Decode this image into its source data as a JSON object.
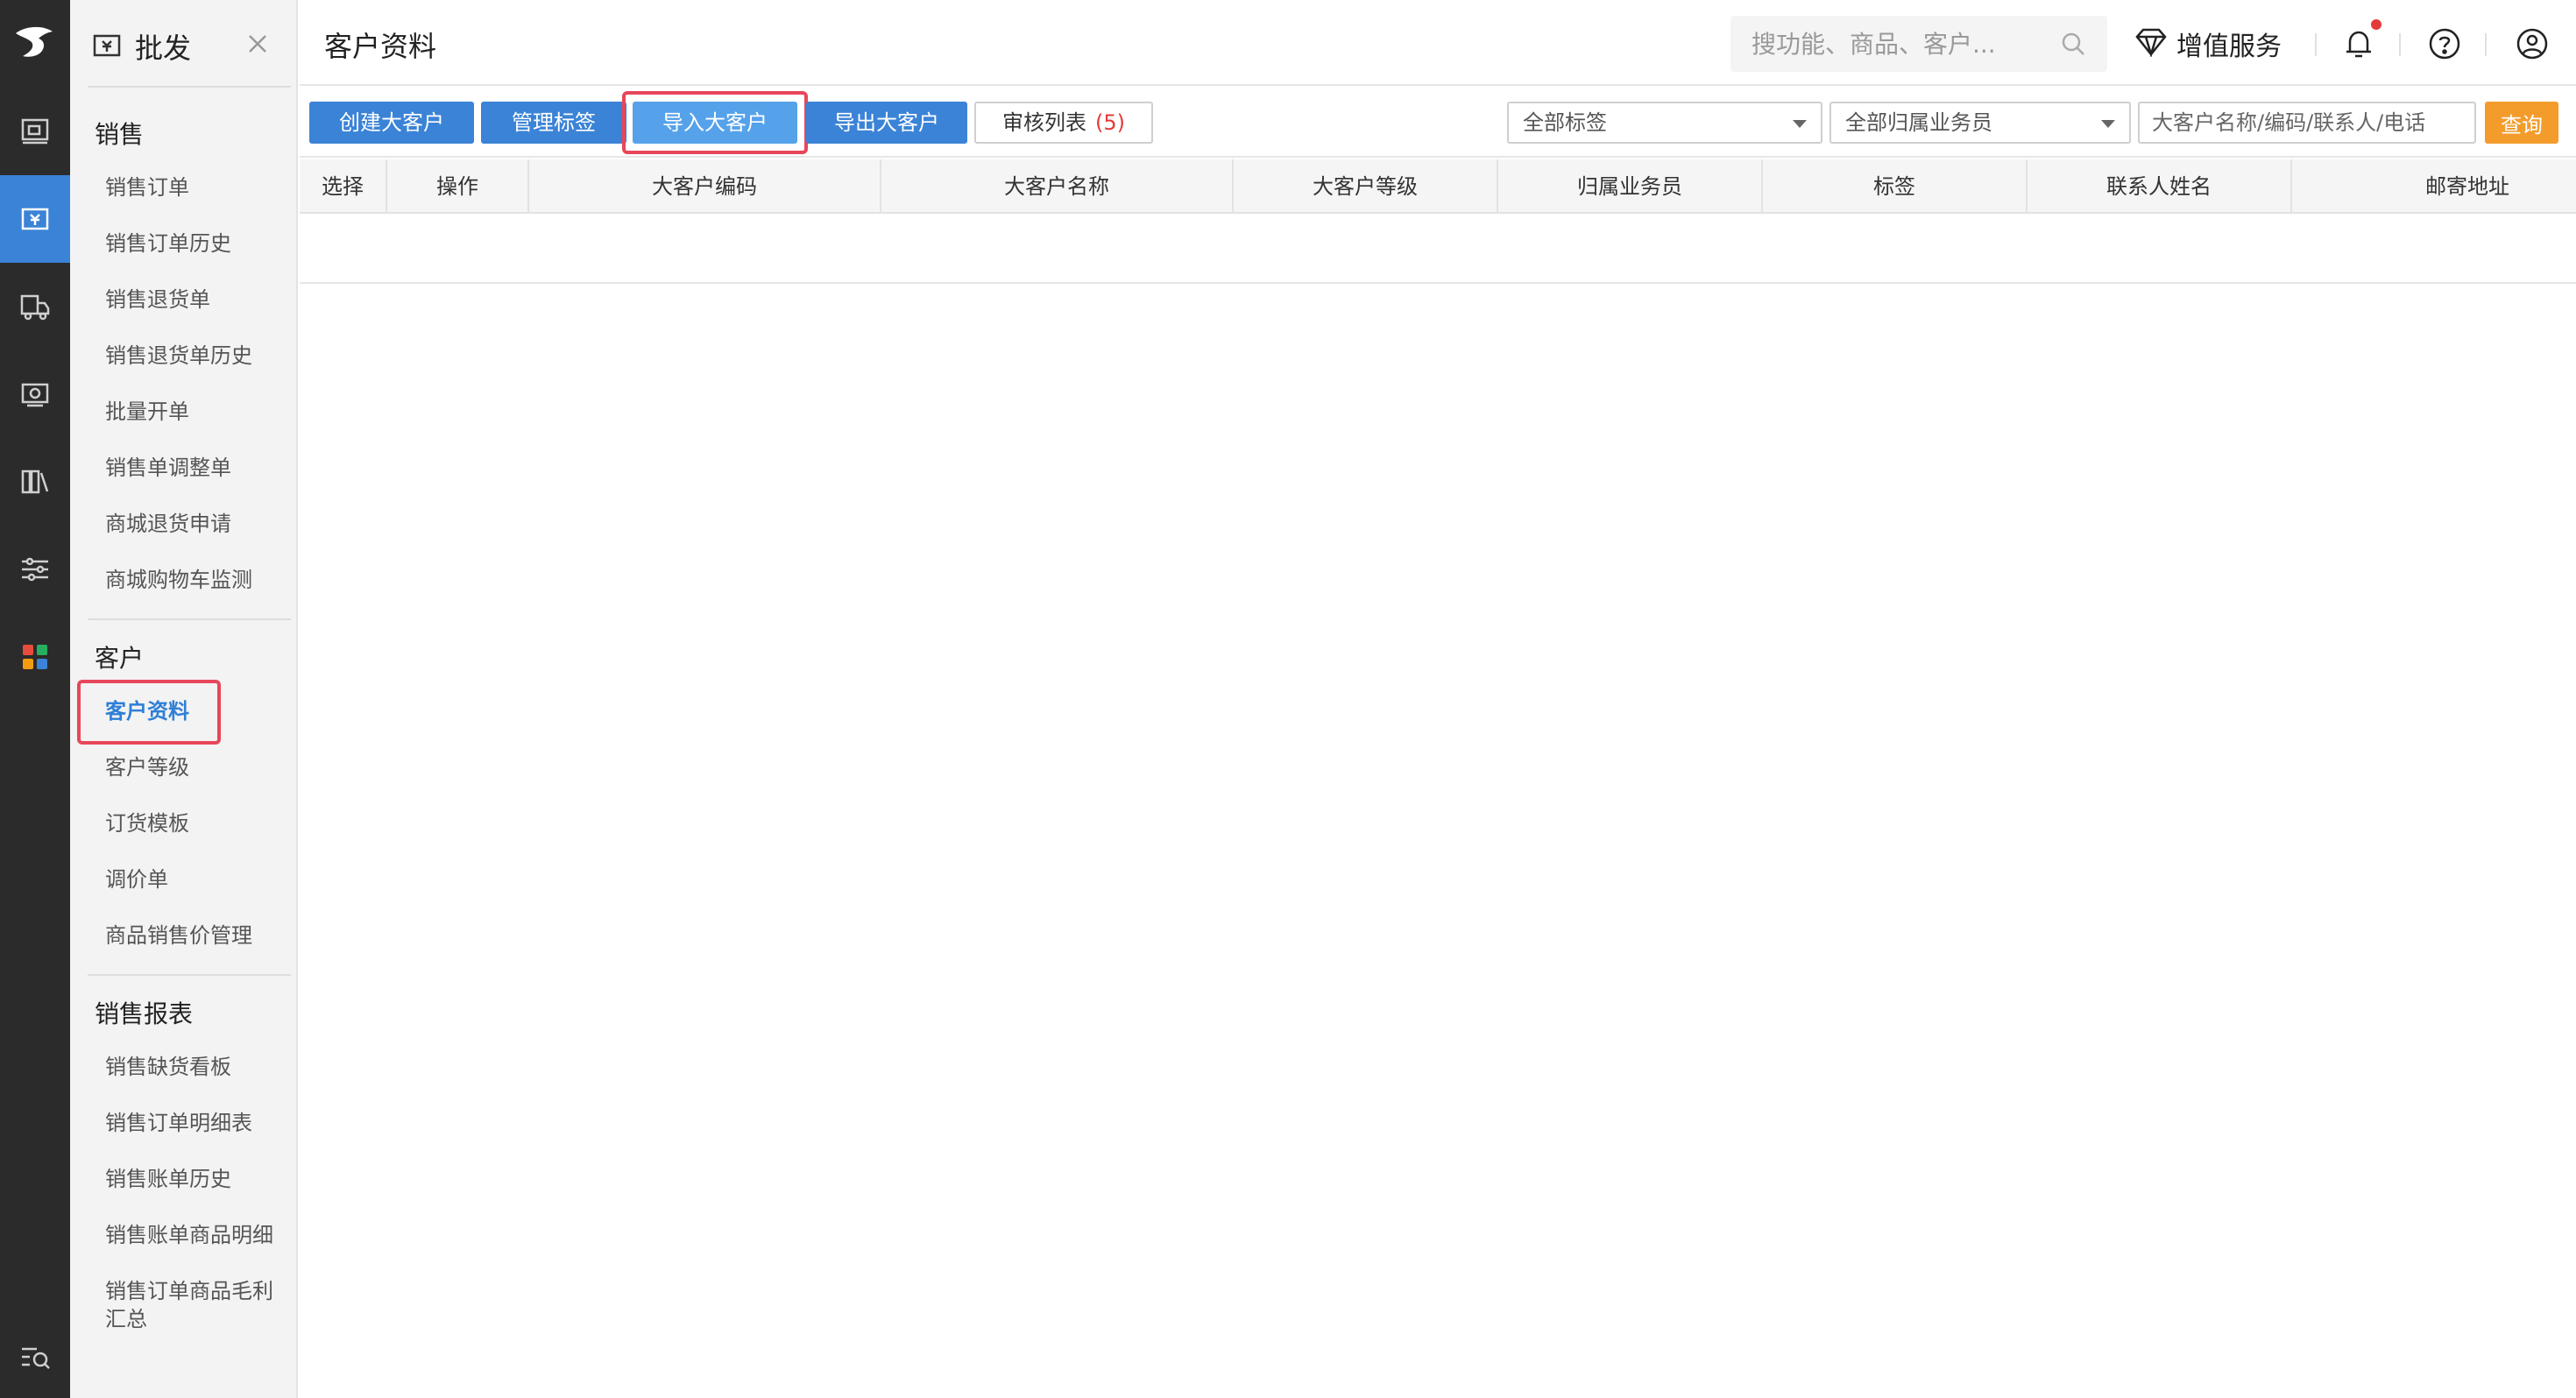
{
  "rail": {
    "items": [
      {
        "name": "monitor-icon"
      },
      {
        "name": "wholesale-icon",
        "active": true
      },
      {
        "name": "truck-icon"
      },
      {
        "name": "money-icon"
      },
      {
        "name": "books-icon"
      },
      {
        "name": "sliders-icon"
      },
      {
        "name": "apps-grid-icon"
      },
      {
        "name": "menu-search-icon"
      }
    ]
  },
  "menu": {
    "title": "批发",
    "groups": [
      {
        "title": "销售",
        "items": [
          "销售订单",
          "销售订单历史",
          "销售退货单",
          "销售退货单历史",
          "批量开单",
          "销售单调整单",
          "商城退货申请",
          "商城购物车监测"
        ]
      },
      {
        "title": "客户",
        "items": [
          "客户资料",
          "客户等级",
          "订货模板",
          "调价单",
          "商品销售价管理"
        ]
      },
      {
        "title": "销售报表",
        "items": [
          "销售缺货看板",
          "销售订单明细表",
          "销售账单历史",
          "销售账单商品明细",
          "销售订单商品毛利汇总"
        ]
      }
    ],
    "active_item": "客户资料"
  },
  "header": {
    "page_title": "客户资料",
    "search_placeholder": "搜功能、商品、客户...",
    "vas_label": "增值服务"
  },
  "toolbar": {
    "create_label": "创建大客户",
    "tags_label": "管理标签",
    "import_label": "导入大客户",
    "export_label": "导出大客户",
    "review_label": "审核列表",
    "review_count": "(5)",
    "tag_select": "全部标签",
    "salesman_select": "全部归属业务员",
    "filter_placeholder": "大客户名称/编码/联系人/电话",
    "query_label": "查询"
  },
  "table": {
    "columns": [
      "选择",
      "操作",
      "大客户编码",
      "大客户名称",
      "大客户等级",
      "归属业务员",
      "标签",
      "联系人姓名",
      "邮寄地址"
    ],
    "rows": []
  },
  "colors": {
    "primary": "#3b83d6",
    "primary_light": "#55a2ea",
    "accent": "#f39c2c",
    "highlight": "#e8465a",
    "rail_bg": "#2b2b2b"
  }
}
